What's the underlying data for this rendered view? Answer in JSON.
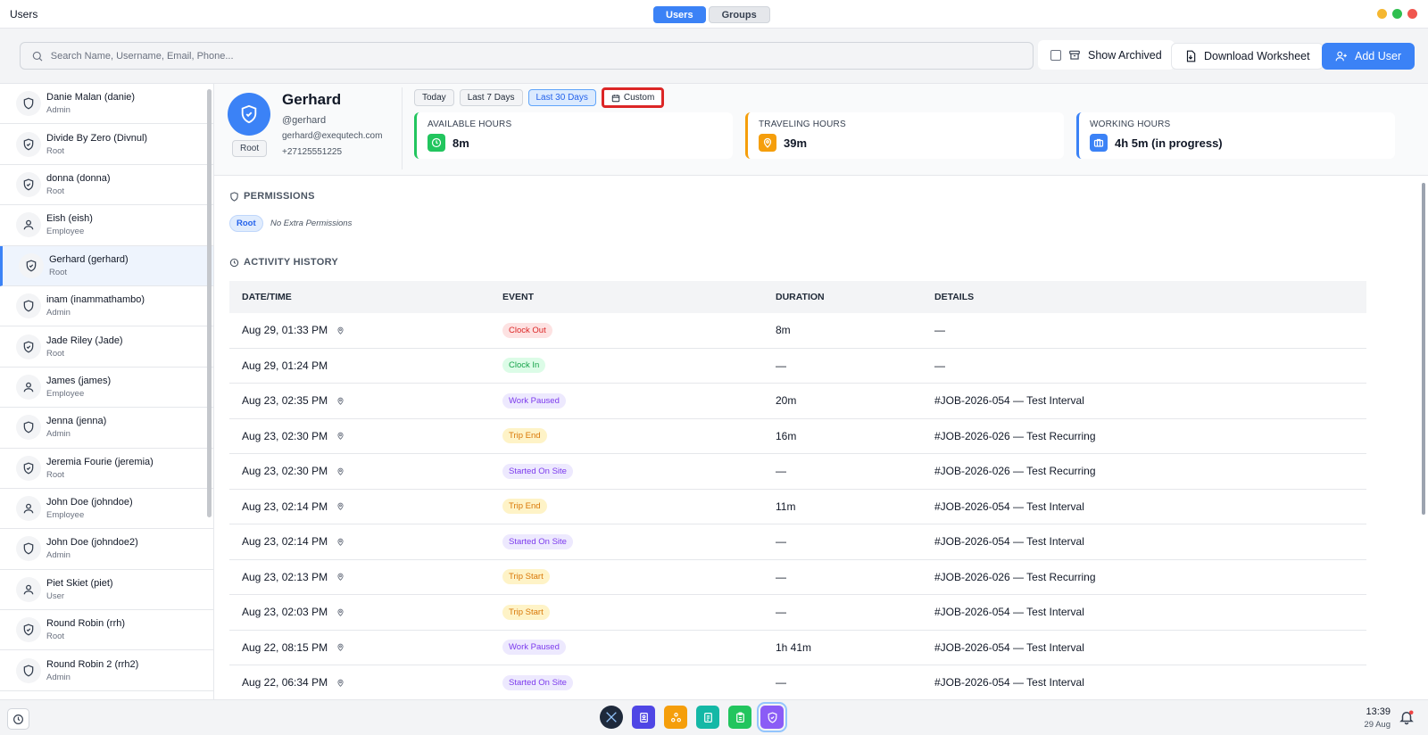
{
  "window": {
    "title": "Users"
  },
  "top_tabs": [
    {
      "label": "Users",
      "active": true
    },
    {
      "label": "Groups",
      "active": false
    }
  ],
  "toolbar": {
    "search_placeholder": "Search Name, Username, Email, Phone...",
    "show_archived_label": "Show Archived",
    "show_archived_checked": false,
    "download_label": "Download Worksheet",
    "add_user_label": "Add User"
  },
  "sidebar": {
    "users": [
      {
        "name": "Danie Malan (danie)",
        "role": "Admin",
        "icon": "shield-icon"
      },
      {
        "name": "Divide By Zero (Divnul)",
        "role": "Root",
        "icon": "shield-check-icon"
      },
      {
        "name": "donna (donna)",
        "role": "Root",
        "icon": "shield-check-icon"
      },
      {
        "name": "Eish (eish)",
        "role": "Employee",
        "icon": "person-icon"
      },
      {
        "name": "Gerhard (gerhard)",
        "role": "Root",
        "icon": "shield-check-icon",
        "selected": true
      },
      {
        "name": "inam (inammathambo)",
        "role": "Admin",
        "icon": "shield-icon"
      },
      {
        "name": "Jade Riley (Jade)",
        "role": "Root",
        "icon": "shield-check-icon"
      },
      {
        "name": "James (james)",
        "role": "Employee",
        "icon": "person-icon"
      },
      {
        "name": "Jenna (jenna)",
        "role": "Admin",
        "icon": "shield-icon"
      },
      {
        "name": "Jeremia Fourie (jeremia)",
        "role": "Root",
        "icon": "shield-check-icon"
      },
      {
        "name": "John Doe (johndoe)",
        "role": "Employee",
        "icon": "person-icon"
      },
      {
        "name": "John Doe (johndoe2)",
        "role": "Admin",
        "icon": "shield-icon"
      },
      {
        "name": "Piet Skiet (piet)",
        "role": "User",
        "icon": "person-icon"
      },
      {
        "name": "Round Robin (rrh)",
        "role": "Root",
        "icon": "shield-check-icon"
      },
      {
        "name": "Round Robin 2 (rrh2)",
        "role": "Admin",
        "icon": "shield-icon"
      }
    ]
  },
  "profile": {
    "name": "Gerhard",
    "username": "@gerhard",
    "email": "gerhard@exequtech.com",
    "phone": "+27125551225",
    "role": "Root"
  },
  "date_ranges": [
    {
      "label": "Today",
      "state": "default"
    },
    {
      "label": "Last 7 Days",
      "state": "default"
    },
    {
      "label": "Last 30 Days",
      "state": "active"
    },
    {
      "label": "Custom",
      "state": "highlighted"
    }
  ],
  "stats": [
    {
      "label": "AVAILABLE HOURS",
      "value": "8m",
      "color": "#22c55e",
      "icon": "clock-icon"
    },
    {
      "label": "TRAVELING HOURS",
      "value": "39m",
      "color": "#f59e0b",
      "icon": "map-pin-icon"
    },
    {
      "label": "WORKING HOURS",
      "value": "4h 5m (in progress)",
      "color": "#3b82f6",
      "icon": "briefcase-icon"
    }
  ],
  "permissions": {
    "title": "PERMISSIONS",
    "role_badge": "Root",
    "extra_text": "No Extra Permissions"
  },
  "activity": {
    "title": "ACTIVITY HISTORY",
    "columns": [
      "DATE/TIME",
      "EVENT",
      "DURATION",
      "DETAILS"
    ],
    "rows": [
      {
        "datetime": "Aug 29, 01:33 PM",
        "has_pin": true,
        "event": "Clock Out",
        "duration": "8m",
        "details": "—"
      },
      {
        "datetime": "Aug 29, 01:24 PM",
        "has_pin": false,
        "event": "Clock In",
        "duration": "—",
        "details": "—"
      },
      {
        "datetime": "Aug 23, 02:35 PM",
        "has_pin": true,
        "event": "Work Paused",
        "duration": "20m",
        "details": "#JOB-2026-054 — Test Interval"
      },
      {
        "datetime": "Aug 23, 02:30 PM",
        "has_pin": true,
        "event": "Trip End",
        "duration": "16m",
        "details": "#JOB-2026-026 — Test Recurring"
      },
      {
        "datetime": "Aug 23, 02:30 PM",
        "has_pin": true,
        "event": "Started On Site",
        "duration": "—",
        "details": "#JOB-2026-026 — Test Recurring"
      },
      {
        "datetime": "Aug 23, 02:14 PM",
        "has_pin": true,
        "event": "Trip End",
        "duration": "11m",
        "details": "#JOB-2026-054 — Test Interval"
      },
      {
        "datetime": "Aug 23, 02:14 PM",
        "has_pin": true,
        "event": "Started On Site",
        "duration": "—",
        "details": "#JOB-2026-054 — Test Interval"
      },
      {
        "datetime": "Aug 23, 02:13 PM",
        "has_pin": true,
        "event": "Trip Start",
        "duration": "—",
        "details": "#JOB-2026-026 — Test Recurring"
      },
      {
        "datetime": "Aug 23, 02:03 PM",
        "has_pin": true,
        "event": "Trip Start",
        "duration": "—",
        "details": "#JOB-2026-054 — Test Interval"
      },
      {
        "datetime": "Aug 22, 08:15 PM",
        "has_pin": true,
        "event": "Work Paused",
        "duration": "1h 41m",
        "details": "#JOB-2026-054 — Test Interval"
      },
      {
        "datetime": "Aug 22, 06:34 PM",
        "has_pin": true,
        "event": "Started On Site",
        "duration": "—",
        "details": "#JOB-2026-054 — Test Interval"
      }
    ]
  },
  "event_styles": {
    "Clock Out": {
      "bg": "#fde2e2",
      "fg": "#dc2626"
    },
    "Clock In": {
      "bg": "#dcfce7",
      "fg": "#16a34a"
    },
    "Work Paused": {
      "bg": "#ede9fe",
      "fg": "#7c3aed"
    },
    "Trip End": {
      "bg": "#fef3c7",
      "fg": "#d97706"
    },
    "Started On Site": {
      "bg": "#ede9fe",
      "fg": "#7c3aed"
    },
    "Trip Start": {
      "bg": "#fef3c7",
      "fg": "#d97706"
    }
  },
  "taskbar": {
    "time": "13:39",
    "date": "29 Aug",
    "apps": [
      {
        "name": "logo-app",
        "color": "#1e293b"
      },
      {
        "name": "contacts-app",
        "color": "#4f46e5"
      },
      {
        "name": "network-app",
        "color": "#f59e0b"
      },
      {
        "name": "document-app",
        "color": "#14b8a6"
      },
      {
        "name": "clipboard-app",
        "color": "#22c55e"
      },
      {
        "name": "users-app",
        "color": "#8b5cf6",
        "active": true
      }
    ]
  }
}
